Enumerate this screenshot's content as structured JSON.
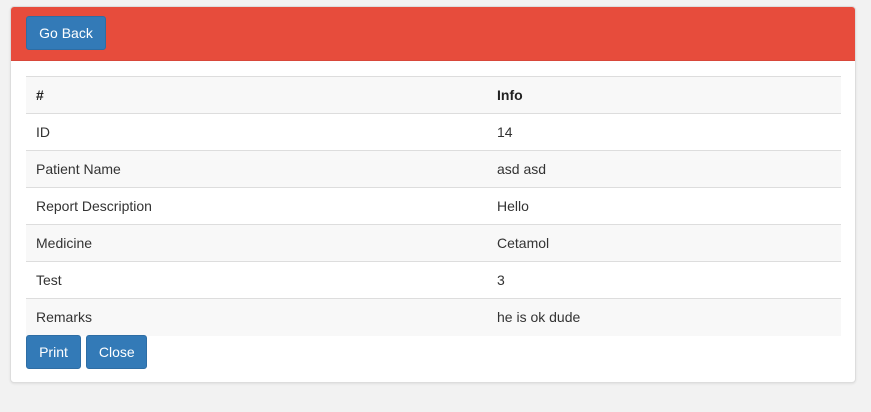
{
  "header": {
    "go_back_label": "Go Back",
    "color": "#e74c3c"
  },
  "table": {
    "columns": [
      "#",
      "Info"
    ],
    "rows": [
      {
        "label": "ID",
        "value": "14"
      },
      {
        "label": "Patient Name",
        "value": "asd asd"
      },
      {
        "label": "Report Description",
        "value": "Hello"
      },
      {
        "label": "Medicine",
        "value": "Cetamol"
      },
      {
        "label": "Test",
        "value": "3"
      },
      {
        "label": "Remarks",
        "value": "he is ok dude"
      }
    ]
  },
  "actions": {
    "print_label": "Print",
    "close_label": "Close",
    "button_color": "#337ab7"
  }
}
